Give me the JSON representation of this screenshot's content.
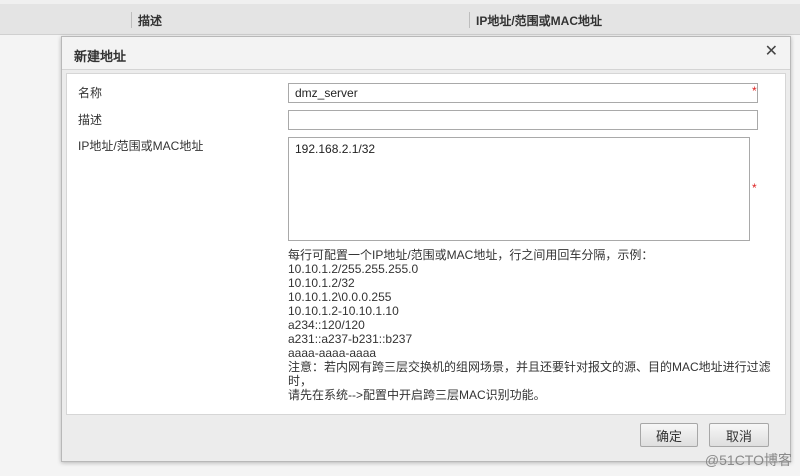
{
  "background_table": {
    "columns": [
      "描述",
      "IP地址/范围或MAC地址"
    ]
  },
  "dialog": {
    "title": "新建地址",
    "close_symbol": "✕",
    "fields": {
      "name": {
        "label": "名称",
        "value": "dmz_server",
        "required_mark": "*"
      },
      "description": {
        "label": "描述",
        "value": ""
      },
      "addresses": {
        "label": "IP地址/范围或MAC地址",
        "value": "192.168.2.1/32",
        "required_mark": "*"
      }
    },
    "help_lines": [
      "每行可配置一个IP地址/范围或MAC地址，行之间用回车分隔，示例：",
      "10.10.1.2/255.255.255.0",
      "10.10.1.2/32",
      "10.10.1.2\\0.0.0.255",
      "10.10.1.2-10.10.1.10",
      "a234::120/120",
      "a231::a237-b231::b237",
      "aaaa-aaaa-aaaa",
      "注意：若内网有跨三层交换机的组网场景，并且还要针对报文的源、目的MAC地址进行过滤时，",
      "请先在系统-->配置中开启跨三层MAC识别功能。"
    ],
    "buttons": {
      "ok": "确定",
      "cancel": "取消"
    }
  },
  "watermark": "@51CTO博客"
}
